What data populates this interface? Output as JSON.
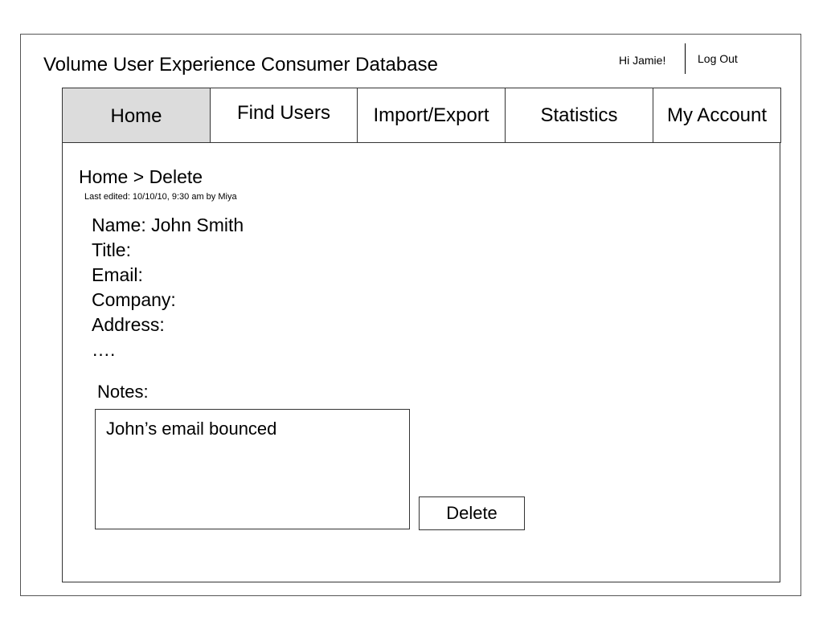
{
  "header": {
    "app_title": "Volume User Experience Consumer Database",
    "greeting": "Hi Jamie!",
    "logout_label": "Log Out"
  },
  "nav": {
    "active": "Home",
    "tabs": [
      {
        "label": "Home"
      },
      {
        "label": "Find Users"
      },
      {
        "label": "Import/Export"
      },
      {
        "label": "Statistics"
      },
      {
        "label": "My Account"
      }
    ]
  },
  "page": {
    "breadcrumb": "Home > Delete",
    "last_edited": "Last edited: 10/10/10, 9:30 am by Miya"
  },
  "record": {
    "lines": [
      "Name: John Smith",
      "Title:",
      "Email:",
      "Company:",
      "Address:",
      "…."
    ]
  },
  "notes": {
    "label": "Notes:",
    "value": "John’s email bounced"
  },
  "actions": {
    "delete_label": "Delete"
  },
  "colors": {
    "active_tab_bg": "#dcdcdc",
    "border": "#333333"
  }
}
